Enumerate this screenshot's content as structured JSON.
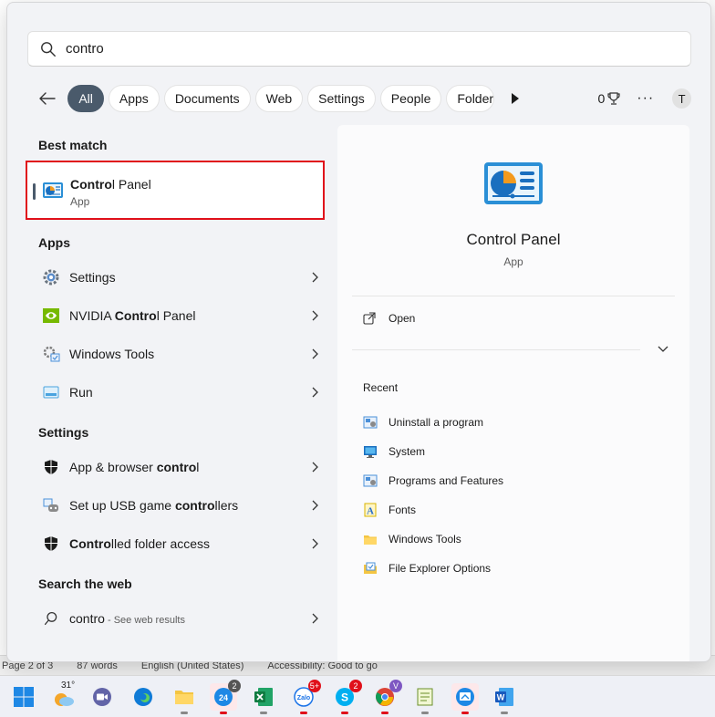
{
  "search": {
    "query": "contro"
  },
  "filters": {
    "chips": [
      "All",
      "Apps",
      "Documents",
      "Web",
      "Settings",
      "People",
      "Folders"
    ],
    "active": "All",
    "points": "0",
    "avatar_letter": "T"
  },
  "best_match": {
    "heading": "Best match",
    "title_bold": "Contro",
    "title_rest": "l Panel",
    "subtitle": "App"
  },
  "apps": {
    "heading": "Apps",
    "items": [
      {
        "pre": "",
        "bold": "",
        "post": "Settings"
      },
      {
        "pre": "NVIDIA ",
        "bold": "Contro",
        "post": "l Panel"
      },
      {
        "pre": "",
        "bold": "",
        "post": "Windows Tools"
      },
      {
        "pre": "",
        "bold": "",
        "post": "Run"
      }
    ]
  },
  "settings": {
    "heading": "Settings",
    "items": [
      {
        "pre": "App & browser ",
        "bold": "contro",
        "post": "l"
      },
      {
        "pre": "Set up USB game ",
        "bold": "contro",
        "post": "llers"
      },
      {
        "pre": "",
        "bold": "Contro",
        "post": "lled folder access"
      }
    ]
  },
  "web": {
    "heading": "Search the web",
    "query": "contro",
    "hint": " - See web results"
  },
  "preview": {
    "title": "Control Panel",
    "subtitle": "App",
    "open_label": "Open",
    "recent_heading": "Recent",
    "recent": [
      "Uninstall a program",
      "System",
      "Programs and Features",
      "Fonts",
      "Windows Tools",
      "File Explorer Options"
    ]
  },
  "background_status": {
    "page": "Page 2 of 3",
    "words": "87 words",
    "language": "English (United States)",
    "accessibility": "Accessibility: Good to go"
  },
  "taskbar": {
    "weather_temp": "31°",
    "badges": {
      "app1": "2",
      "zalo": "5+",
      "skype": "2",
      "viber": "V"
    }
  },
  "colors": {
    "accent": "#4a5a6b",
    "highlight_border": "#e0101a",
    "taskbar_indicator": "#e0101a"
  }
}
